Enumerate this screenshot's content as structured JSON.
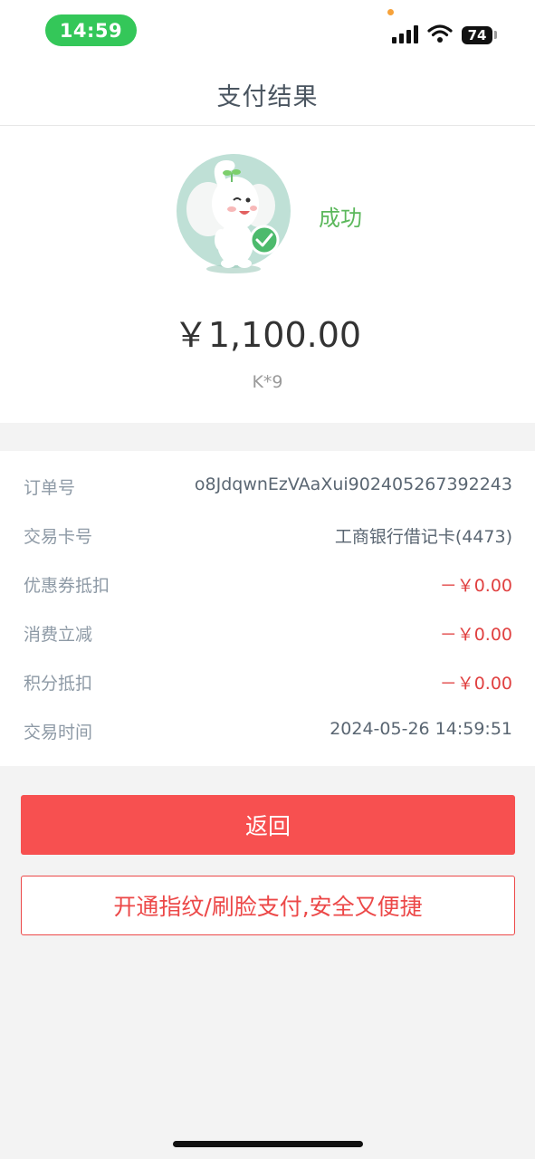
{
  "status_bar": {
    "time": "14:59",
    "battery": "74",
    "icons": [
      "signal-icon",
      "wifi-icon",
      "battery-icon"
    ]
  },
  "nav": {
    "title": "支付结果"
  },
  "result": {
    "status": "成功",
    "amount": "￥1,100.00",
    "merchant": "K*9",
    "status_color": "#5cb85c"
  },
  "details": {
    "rows": [
      {
        "label": "订单号",
        "value": "o8JdqwnEzVAaXui902405267392243"
      },
      {
        "label": "交易卡号",
        "value": "工商银行借记卡(4473)"
      },
      {
        "label": "优惠券抵扣",
        "value": "－￥0.00"
      },
      {
        "label": "消费立减",
        "value": "－￥0.00"
      },
      {
        "label": "积分抵扣",
        "value": "－￥0.00"
      },
      {
        "label": "交易时间",
        "value": "2024-05-26 14:59:51"
      }
    ]
  },
  "buttons": {
    "back_label": "返回",
    "open_biometric_label": "开通指纹/刷脸支付,安全又便捷"
  },
  "colors": {
    "accent_red": "#f75050",
    "success_green": "#34c759"
  }
}
